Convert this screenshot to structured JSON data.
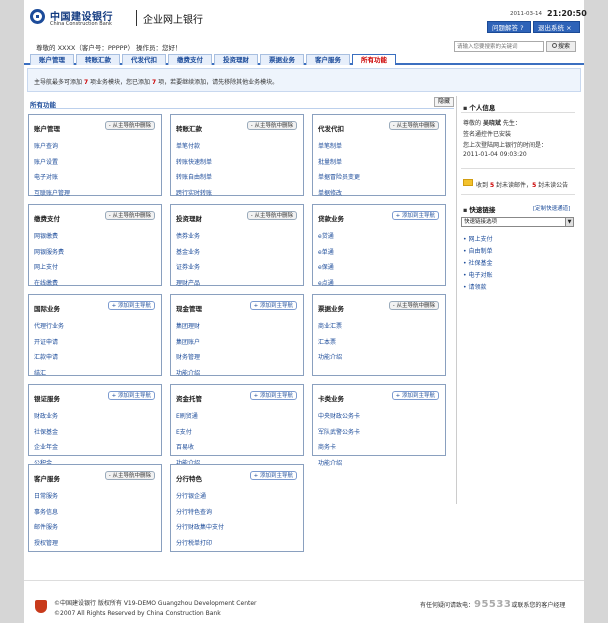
{
  "header": {
    "brand_cn": "中国建设银行",
    "brand_en": "China Construction Bank",
    "subtitle": "企业网上银行",
    "date": "2011-03-14",
    "time": "21:20:50",
    "help_button": "问题解答",
    "exit_button": "退出系统"
  },
  "userbar": {
    "greeting": "尊敬的 XXXX（客户号：PPPPP） 操作员：您好！",
    "search_placeholder": "请输入您要搜索的关键词",
    "search_button": "搜索"
  },
  "tabs": [
    {
      "label": "账户管理",
      "active": false
    },
    {
      "label": "转账汇款",
      "active": false
    },
    {
      "label": "代发代扣",
      "active": false
    },
    {
      "label": "缴费支付",
      "active": false
    },
    {
      "label": "投资理财",
      "active": false
    },
    {
      "label": "票据业务",
      "active": false
    },
    {
      "label": "客户服务",
      "active": false
    },
    {
      "label": "所有功能",
      "active": true
    }
  ],
  "notice": {
    "prefix": "主导航最多可添加",
    "max": "7",
    "middle": "项业务模块，您已添加",
    "added": "7",
    "suffix": "项，若要继续添加，请先移除其他业务模块。"
  },
  "main": {
    "title": "所有功能",
    "hide_button": "隐藏",
    "remove_label": "从主导航中删除",
    "add_label": "添加到主导航",
    "boxes": [
      {
        "title": "账户管理",
        "action": "remove",
        "items": [
          "账户查询",
          "账户设置",
          "电子对账",
          "互联账户管理"
        ]
      },
      {
        "title": "转账汇款",
        "action": "remove",
        "items": [
          "单笔付款",
          "转账快速制单",
          "转账自由制单",
          "跨行实时转账"
        ]
      },
      {
        "title": "代发代扣",
        "action": "remove",
        "items": [
          "单笔制单",
          "批量制单",
          "单据冒险员变更",
          "单据修改"
        ]
      },
      {
        "title": "缴费支付",
        "action": "remove",
        "items": [
          "网银缴费",
          "网银服务费",
          "网上支付",
          "在线缴费"
        ]
      },
      {
        "title": "投资理财",
        "action": "remove",
        "items": [
          "债券业务",
          "基金业务",
          "证券业务",
          "理财产品"
        ]
      },
      {
        "title": "贷款业务",
        "action": "add",
        "items": [
          "e贷通",
          "e单通",
          "e保通",
          "e点通"
        ]
      },
      {
        "title": "国际业务",
        "action": "add",
        "items": [
          "代理行业务",
          "开证申请",
          "汇款申请",
          "结汇"
        ]
      },
      {
        "title": "现金管理",
        "action": "add",
        "items": [
          "集团理财",
          "集团账户",
          "财务管理",
          "功能介绍"
        ]
      },
      {
        "title": "票据业务",
        "action": "remove",
        "items": [
          "商业汇票",
          "汇本票",
          "功能介绍"
        ]
      },
      {
        "title": "银证服务",
        "action": "add",
        "items": [
          "财政业务",
          "社保基金",
          "企业年金",
          "公积金"
        ]
      },
      {
        "title": "资金托管",
        "action": "add",
        "items": [
          "E刷贸通",
          "E支付",
          "百易收",
          "功能介绍"
        ]
      },
      {
        "title": "卡类业务",
        "action": "add",
        "items": [
          "中央财政公务卡",
          "军队武警公务卡",
          "商务卡",
          "功能介绍"
        ]
      },
      {
        "title": "客户服务",
        "action": "remove",
        "items": [
          "日常服务",
          "事务信息",
          "邮件服务",
          "授权管理"
        ]
      },
      {
        "title": "分行特色",
        "action": "add",
        "items": [
          "分行银企通",
          "分行特色查询",
          "分行财政集中支付",
          "分行税单打印"
        ]
      }
    ]
  },
  "sidebar": {
    "info_title": "个人信息",
    "salute": "尊敬的",
    "name": "吴晓斌",
    "salute_suffix": "先生：",
    "cert": "签名通控件已安装",
    "last_login_label": "您上次登陆网上银行的时间是：",
    "last_login": "2011-01-04 09:03:20",
    "mail_text_1": "收到",
    "mail_count": "5",
    "mail_text_2": "封未读邮件，",
    "notice_count": "5",
    "mail_text_3": "封未读公告",
    "quick_title": "快速链接",
    "custom_link": "[定制快速通道]",
    "quick_select": "快速链接选项",
    "quick_links": [
      "网上支付",
      "自由制单",
      "社保基金",
      "电子对账",
      "请领款"
    ]
  },
  "footer": {
    "line1": "©中国建设银行 版权所有 V19-DEMO Guangzhou Development Center",
    "line2": "©2007 All Rights Reserved by China Construction Bank",
    "phone_prefix": "有任何疑问请致电：",
    "phone": "95533",
    "phone_suffix": "或联系您的客户经理"
  },
  "colors": {
    "brand": "#1d4c9a",
    "accent_red": "#cc0000",
    "tab_bg": "#e7effb"
  }
}
